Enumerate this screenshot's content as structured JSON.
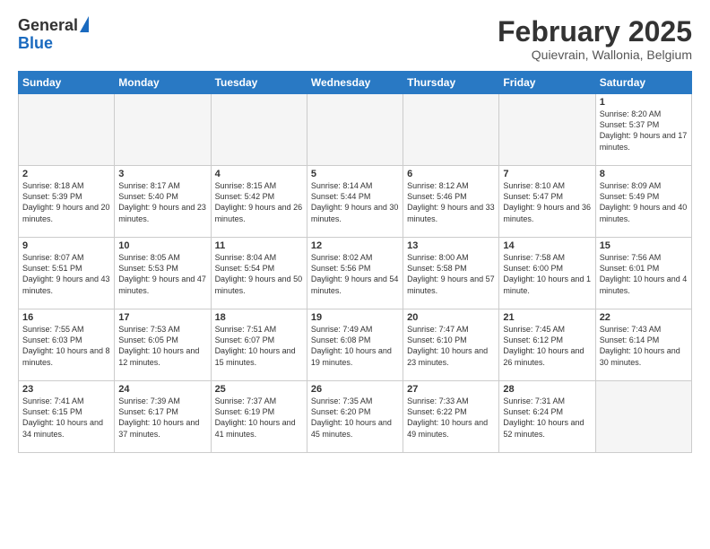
{
  "logo": {
    "general": "General",
    "blue": "Blue"
  },
  "header": {
    "month": "February 2025",
    "location": "Quievrain, Wallonia, Belgium"
  },
  "weekdays": [
    "Sunday",
    "Monday",
    "Tuesday",
    "Wednesday",
    "Thursday",
    "Friday",
    "Saturday"
  ],
  "weeks": [
    [
      {
        "day": "",
        "sunrise": "",
        "sunset": "",
        "daylight": "",
        "empty": true
      },
      {
        "day": "",
        "sunrise": "",
        "sunset": "",
        "daylight": "",
        "empty": true
      },
      {
        "day": "",
        "sunrise": "",
        "sunset": "",
        "daylight": "",
        "empty": true
      },
      {
        "day": "",
        "sunrise": "",
        "sunset": "",
        "daylight": "",
        "empty": true
      },
      {
        "day": "",
        "sunrise": "",
        "sunset": "",
        "daylight": "",
        "empty": true
      },
      {
        "day": "",
        "sunrise": "",
        "sunset": "",
        "daylight": "",
        "empty": true
      },
      {
        "day": "1",
        "sunrise": "Sunrise: 8:20 AM",
        "sunset": "Sunset: 5:37 PM",
        "daylight": "Daylight: 9 hours and 17 minutes.",
        "empty": false
      }
    ],
    [
      {
        "day": "2",
        "sunrise": "Sunrise: 8:18 AM",
        "sunset": "Sunset: 5:39 PM",
        "daylight": "Daylight: 9 hours and 20 minutes.",
        "empty": false
      },
      {
        "day": "3",
        "sunrise": "Sunrise: 8:17 AM",
        "sunset": "Sunset: 5:40 PM",
        "daylight": "Daylight: 9 hours and 23 minutes.",
        "empty": false
      },
      {
        "day": "4",
        "sunrise": "Sunrise: 8:15 AM",
        "sunset": "Sunset: 5:42 PM",
        "daylight": "Daylight: 9 hours and 26 minutes.",
        "empty": false
      },
      {
        "day": "5",
        "sunrise": "Sunrise: 8:14 AM",
        "sunset": "Sunset: 5:44 PM",
        "daylight": "Daylight: 9 hours and 30 minutes.",
        "empty": false
      },
      {
        "day": "6",
        "sunrise": "Sunrise: 8:12 AM",
        "sunset": "Sunset: 5:46 PM",
        "daylight": "Daylight: 9 hours and 33 minutes.",
        "empty": false
      },
      {
        "day": "7",
        "sunrise": "Sunrise: 8:10 AM",
        "sunset": "Sunset: 5:47 PM",
        "daylight": "Daylight: 9 hours and 36 minutes.",
        "empty": false
      },
      {
        "day": "8",
        "sunrise": "Sunrise: 8:09 AM",
        "sunset": "Sunset: 5:49 PM",
        "daylight": "Daylight: 9 hours and 40 minutes.",
        "empty": false
      }
    ],
    [
      {
        "day": "9",
        "sunrise": "Sunrise: 8:07 AM",
        "sunset": "Sunset: 5:51 PM",
        "daylight": "Daylight: 9 hours and 43 minutes.",
        "empty": false
      },
      {
        "day": "10",
        "sunrise": "Sunrise: 8:05 AM",
        "sunset": "Sunset: 5:53 PM",
        "daylight": "Daylight: 9 hours and 47 minutes.",
        "empty": false
      },
      {
        "day": "11",
        "sunrise": "Sunrise: 8:04 AM",
        "sunset": "Sunset: 5:54 PM",
        "daylight": "Daylight: 9 hours and 50 minutes.",
        "empty": false
      },
      {
        "day": "12",
        "sunrise": "Sunrise: 8:02 AM",
        "sunset": "Sunset: 5:56 PM",
        "daylight": "Daylight: 9 hours and 54 minutes.",
        "empty": false
      },
      {
        "day": "13",
        "sunrise": "Sunrise: 8:00 AM",
        "sunset": "Sunset: 5:58 PM",
        "daylight": "Daylight: 9 hours and 57 minutes.",
        "empty": false
      },
      {
        "day": "14",
        "sunrise": "Sunrise: 7:58 AM",
        "sunset": "Sunset: 6:00 PM",
        "daylight": "Daylight: 10 hours and 1 minute.",
        "empty": false
      },
      {
        "day": "15",
        "sunrise": "Sunrise: 7:56 AM",
        "sunset": "Sunset: 6:01 PM",
        "daylight": "Daylight: 10 hours and 4 minutes.",
        "empty": false
      }
    ],
    [
      {
        "day": "16",
        "sunrise": "Sunrise: 7:55 AM",
        "sunset": "Sunset: 6:03 PM",
        "daylight": "Daylight: 10 hours and 8 minutes.",
        "empty": false
      },
      {
        "day": "17",
        "sunrise": "Sunrise: 7:53 AM",
        "sunset": "Sunset: 6:05 PM",
        "daylight": "Daylight: 10 hours and 12 minutes.",
        "empty": false
      },
      {
        "day": "18",
        "sunrise": "Sunrise: 7:51 AM",
        "sunset": "Sunset: 6:07 PM",
        "daylight": "Daylight: 10 hours and 15 minutes.",
        "empty": false
      },
      {
        "day": "19",
        "sunrise": "Sunrise: 7:49 AM",
        "sunset": "Sunset: 6:08 PM",
        "daylight": "Daylight: 10 hours and 19 minutes.",
        "empty": false
      },
      {
        "day": "20",
        "sunrise": "Sunrise: 7:47 AM",
        "sunset": "Sunset: 6:10 PM",
        "daylight": "Daylight: 10 hours and 23 minutes.",
        "empty": false
      },
      {
        "day": "21",
        "sunrise": "Sunrise: 7:45 AM",
        "sunset": "Sunset: 6:12 PM",
        "daylight": "Daylight: 10 hours and 26 minutes.",
        "empty": false
      },
      {
        "day": "22",
        "sunrise": "Sunrise: 7:43 AM",
        "sunset": "Sunset: 6:14 PM",
        "daylight": "Daylight: 10 hours and 30 minutes.",
        "empty": false
      }
    ],
    [
      {
        "day": "23",
        "sunrise": "Sunrise: 7:41 AM",
        "sunset": "Sunset: 6:15 PM",
        "daylight": "Daylight: 10 hours and 34 minutes.",
        "empty": false
      },
      {
        "day": "24",
        "sunrise": "Sunrise: 7:39 AM",
        "sunset": "Sunset: 6:17 PM",
        "daylight": "Daylight: 10 hours and 37 minutes.",
        "empty": false
      },
      {
        "day": "25",
        "sunrise": "Sunrise: 7:37 AM",
        "sunset": "Sunset: 6:19 PM",
        "daylight": "Daylight: 10 hours and 41 minutes.",
        "empty": false
      },
      {
        "day": "26",
        "sunrise": "Sunrise: 7:35 AM",
        "sunset": "Sunset: 6:20 PM",
        "daylight": "Daylight: 10 hours and 45 minutes.",
        "empty": false
      },
      {
        "day": "27",
        "sunrise": "Sunrise: 7:33 AM",
        "sunset": "Sunset: 6:22 PM",
        "daylight": "Daylight: 10 hours and 49 minutes.",
        "empty": false
      },
      {
        "day": "28",
        "sunrise": "Sunrise: 7:31 AM",
        "sunset": "Sunset: 6:24 PM",
        "daylight": "Daylight: 10 hours and 52 minutes.",
        "empty": false
      },
      {
        "day": "",
        "sunrise": "",
        "sunset": "",
        "daylight": "",
        "empty": true
      }
    ]
  ]
}
